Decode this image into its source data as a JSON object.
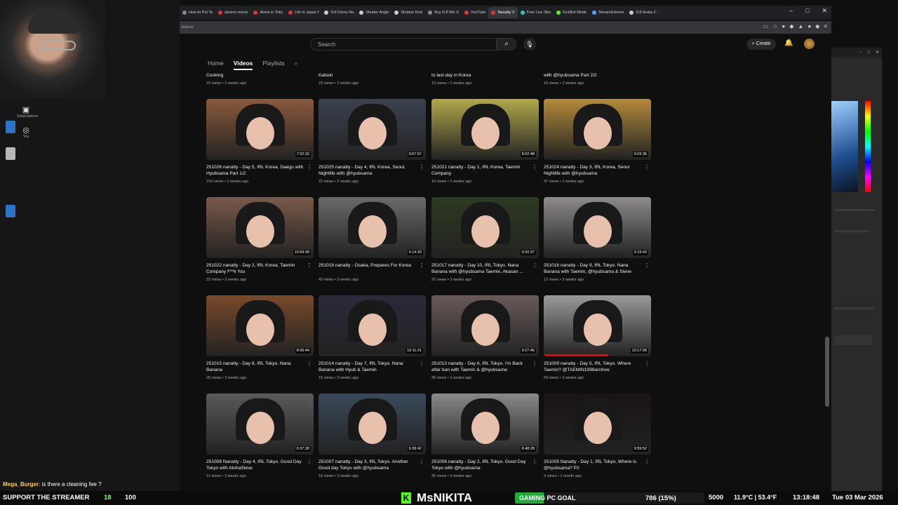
{
  "browser": {
    "tabs": [
      {
        "label": "How to Put Te",
        "color": "#888888"
      },
      {
        "label": "davinci resolv",
        "color": "#e33333"
      },
      {
        "label": "Alone in Toky",
        "color": "#e33333"
      },
      {
        "label": "Life in Japan f",
        "color": "#e33333"
      },
      {
        "label": "DJI Osmo Na",
        "color": "#cccccc"
      },
      {
        "label": "Shutter Angle",
        "color": "#cccccc"
      },
      {
        "label": "Shobon Kick",
        "color": "#cccccc"
      },
      {
        "label": "Buy DJI Mic S",
        "color": "#888888"
      },
      {
        "label": "YouTube",
        "color": "#e33333"
      },
      {
        "label": "Nanatty V",
        "color": "#e33333",
        "active": true
      },
      {
        "label": "Free Live Stre",
        "color": "#2ec5c5"
      },
      {
        "label": "KickBot Mode",
        "color": "#53fc18"
      },
      {
        "label": "StreamElemen",
        "color": "#4aa3ff"
      },
      {
        "label": "DJI Avata 2 -",
        "color": "#cccccc"
      }
    ],
    "address": "/videos"
  },
  "youtube": {
    "search_placeholder": "Search",
    "create_label": "Create",
    "channel_tabs": [
      "Home",
      "Videos",
      "Playlists"
    ],
    "top_row": [
      {
        "title": "Cooking",
        "meta": "10 views • 2 weeks ago"
      },
      {
        "title": "Kabuki",
        "meta": "23 views • 2 weeks ago"
      },
      {
        "title": "to last day in Korea",
        "meta": "13 views • 2 weeks ago"
      },
      {
        "title": "with @hyubsama Part 2/2",
        "meta": "16 views • 2 weeks ago"
      }
    ],
    "videos": [
      {
        "title": "251026 nanatty - Day 5, IRL Korea, Daegu with Hyubsama Part 1/2",
        "meta": "153 views • 2 weeks ago",
        "duration": "7:02:32",
        "bg": "#8a5a3c"
      },
      {
        "title": "251025 nanatty - Day 4, IRL Korea, Seoul, Nightlife with @hyubsama",
        "meta": "22 views • 2 weeks ago",
        "duration": "9:57:57",
        "bg": "#3c4250"
      },
      {
        "title": "251021 nanatty - Day 1, IRL Korea, Taemin Company",
        "meta": "10 views • 2 weeks ago",
        "duration": "8:02:48",
        "bg": "#b2a84a"
      },
      {
        "title": "251024 nanatty - Day 3, IRL Korea, Seoul Nightlife with @hyubsama",
        "meta": "47 views • 2 weeks ago",
        "duration": "9:03:36",
        "bg": "#b58a3a"
      },
      {
        "title": "251022 nanatty - Day 2, IRL Korea, Taemin Company F**k You",
        "meta": "32 views • 2 weeks ago",
        "duration": "10:59:39",
        "bg": "#7a5a4a"
      },
      {
        "title": "251018 nanatty - Osaka, Prepares For Korea",
        "meta": "43 views • 3 weeks ago",
        "duration": "4:14:33",
        "bg": "#6a6a6a"
      },
      {
        "title": "251017 nanatty - Day 10, IRL Tokyo. Nana Banana with @hyubsama Taemin, Akasan ...",
        "meta": "25 views • 3 weeks ago",
        "duration": "9:20:37",
        "bg": "#2e3a22"
      },
      {
        "title": "251016 nanatty - Day 9, IRL Tokyo. Nana Banana with Taemin, @hyubsama & Steve",
        "meta": "12 views • 3 weeks ago",
        "duration": "9:19:43",
        "bg": "#8e8a8e"
      },
      {
        "title": "251015 nanatty - Day 8, IRL Tokyo. Nana Banana",
        "meta": "25 views • 3 weeks ago",
        "duration": "8:06:44",
        "bg": "#7a4a2a"
      },
      {
        "title": "251014 nanatty - Day 7, IRL Tokyo. Nana Banana with Hyub & Taemin",
        "meta": "15 views • 3 weeks ago",
        "duration": "10:11:21",
        "bg": "#2a2a3a"
      },
      {
        "title": "251013 nanatty - Day 6, IRL Tokyo. I'm Back after ban with Taemin & @hyubsama",
        "meta": "36 views • 3 weeks ago",
        "duration": "9:27:45",
        "bg": "#6a5a5a"
      },
      {
        "title": "251009 nanatty - Day 5, IRL Tokyo. Where Taemin? @TAEMIN1998archive",
        "meta": "59 views • 3 weeks ago",
        "duration": "10:17:06",
        "bg": "#9a9a9a",
        "watched": 0.6
      },
      {
        "title": "251008 Nanatty - Day 4, IRL Tokyo. Good Day Tokyo with AlohaSteve",
        "meta": "11 views • 3 weeks ago",
        "duration": "6:37:28",
        "bg": "#5a5a5a"
      },
      {
        "title": "251007 nanatty - Day 3, IRL Tokyo. Another Good day Tokyo with @hyubsama",
        "meta": "16 views • 3 weeks ago",
        "duration": "6:38:42",
        "bg": "#3a4a5a"
      },
      {
        "title": "251006 nanatty - Day 2, IRL Tokyo. Good Day Tokyo with @hyubsama",
        "meta": "35 views • 3 weeks ago",
        "duration": "8:48:28",
        "bg": "#8a8a8a"
      },
      {
        "title": "251005 Nanatty - Day 1, IRL Tokyo, Where is @hyubsama? P2",
        "meta": "9 views • 1 month ago",
        "duration": "9:59:52",
        "bg": "#1a1414"
      }
    ]
  },
  "left": {
    "subscriptions_label": "Subscriptions",
    "you_label": "You"
  },
  "stream": {
    "chat_user": "Mega_Burger",
    "chat_message": ": is there a cleaning fee ?",
    "support_text": "SUPPORT THE STREAMER",
    "count_a": "18",
    "count_b": "100",
    "streamer_name": "MsNIKITA",
    "goal_label": "GAMING PC GOAL",
    "goal_progress": "786 (15%)",
    "goal_fraction": 0.15,
    "goal_target": "5000",
    "weather": "11.9°C | 53.4°F",
    "clock": "13:18:48",
    "date": "Tue 03 Mar 2026"
  }
}
